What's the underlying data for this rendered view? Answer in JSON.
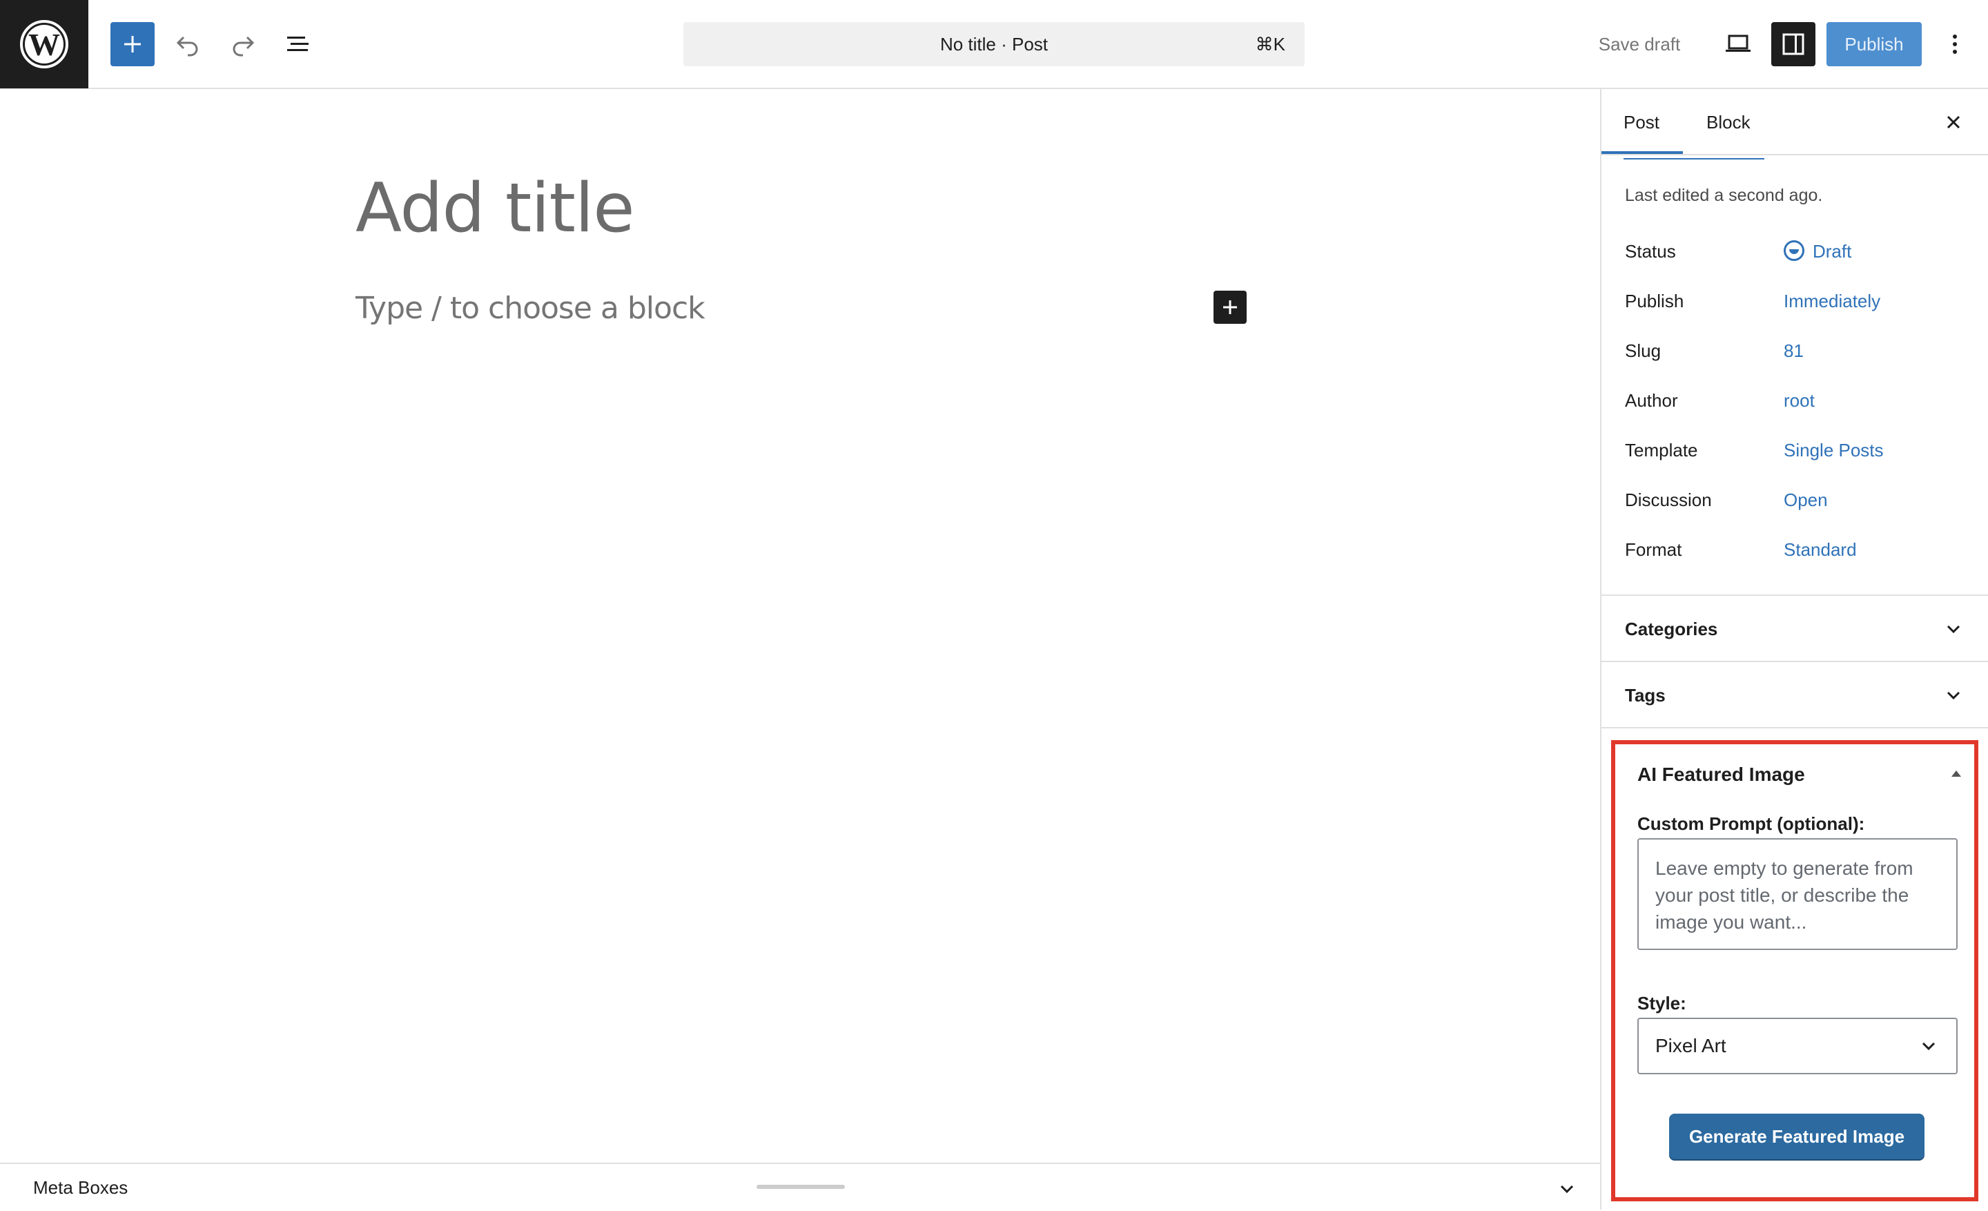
{
  "topbar": {
    "logo_icon": "wordpress-logo-icon",
    "add_block_icon": "plus-icon",
    "undo_icon": "undo-icon",
    "redo_icon": "redo-icon",
    "list_view_icon": "list-view-icon",
    "command_title": "No title · Post",
    "command_shortcut": "⌘K",
    "save_draft": "Save draft",
    "preview_icon": "laptop-icon",
    "settings_icon": "sidebar-toggle-icon",
    "publish": "Publish",
    "options_icon": "more-vertical-icon",
    "colors": {
      "accent": "#2f72b8",
      "publish_bg": "#4e8fd0",
      "dark": "#1e1e1e"
    }
  },
  "editor": {
    "title_placeholder": "Add title",
    "block_placeholder": "Type / to choose a block",
    "inline_add_icon": "plus-icon"
  },
  "metabox": {
    "label": "Meta Boxes",
    "toggle_icon": "chevron-down-icon"
  },
  "sidebar": {
    "tabs": [
      {
        "label": "Post",
        "active": true
      },
      {
        "label": "Block",
        "active": false
      }
    ],
    "close_icon": "close-icon",
    "last_edited": "Last edited a second ago.",
    "meta": [
      {
        "key": "Status",
        "value": "Draft",
        "icon": "draft-status-icon"
      },
      {
        "key": "Publish",
        "value": "Immediately"
      },
      {
        "key": "Slug",
        "value": "81"
      },
      {
        "key": "Author",
        "value": "root"
      },
      {
        "key": "Template",
        "value": "Single Posts"
      },
      {
        "key": "Discussion",
        "value": "Open"
      },
      {
        "key": "Format",
        "value": "Standard"
      }
    ],
    "panels": [
      {
        "title": "Categories",
        "icon": "chevron-down-icon"
      },
      {
        "title": "Tags",
        "icon": "chevron-down-icon"
      }
    ],
    "ai": {
      "title": "AI Featured Image",
      "collapse_icon": "triangle-up-icon",
      "prompt_label": "Custom Prompt (optional):",
      "prompt_placeholder": "Leave empty to generate from your post title, or describe the image you want...",
      "prompt_value": "",
      "style_label": "Style:",
      "style_value": "Pixel Art",
      "style_icon": "chevron-down-icon",
      "generate_button": "Generate Featured Image",
      "highlight_color": "#e0382b"
    }
  }
}
